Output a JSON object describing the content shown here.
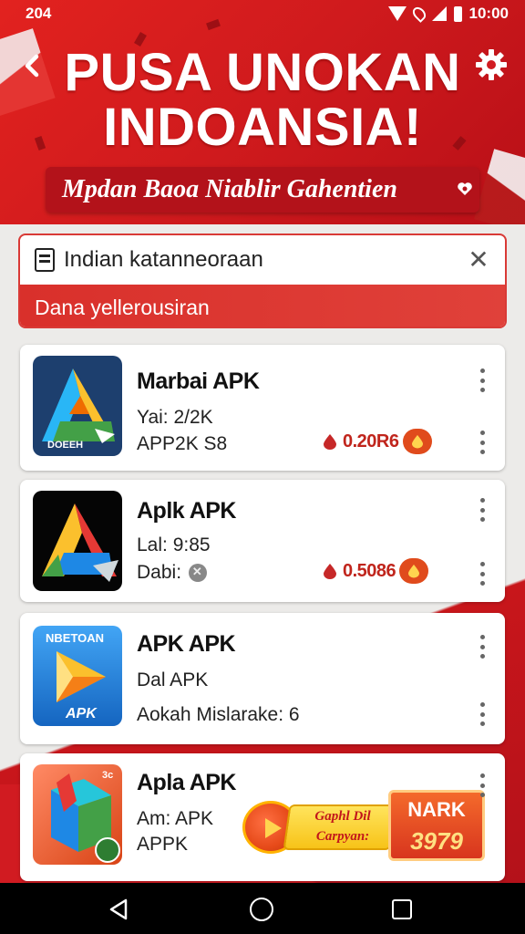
{
  "status_bar": {
    "left_text": "204",
    "time": "10:00"
  },
  "header": {
    "title_line1": "PUSA UNOKAN",
    "title_line2": "INDOANSIA!",
    "subtitle": "Mpdan Baoa Niablir Gahentien",
    "colors": {
      "primary": "#d11b21",
      "dark": "#b3121a"
    }
  },
  "search": {
    "value": "Indian katanneoraan",
    "suggestion": "Dana yellerousiran"
  },
  "apps": [
    {
      "name": "Marbai APK",
      "line1": "Yai: 2/2K",
      "line2": "APP2K S8",
      "icon_label": "DOEEH",
      "price": "0.20R6"
    },
    {
      "name": "Aplk APK",
      "line1": "Lal: 9:85",
      "line2": "Dabi:",
      "price": "0.5086"
    },
    {
      "name": "APK APK",
      "line1": "Dal APK",
      "line2": "Aokah Mislarake: 6",
      "icon_top_label": "NBETOAN",
      "icon_bottom_label": "APK"
    },
    {
      "name": "Apla APK",
      "line1": "Am: APK",
      "line2": "APPK",
      "icon_corner_label": "3c",
      "promo_play_text": "Gaphl Dil Carpyan:",
      "promo_mark_title": "NARK",
      "promo_mark_value": "3979"
    }
  ]
}
